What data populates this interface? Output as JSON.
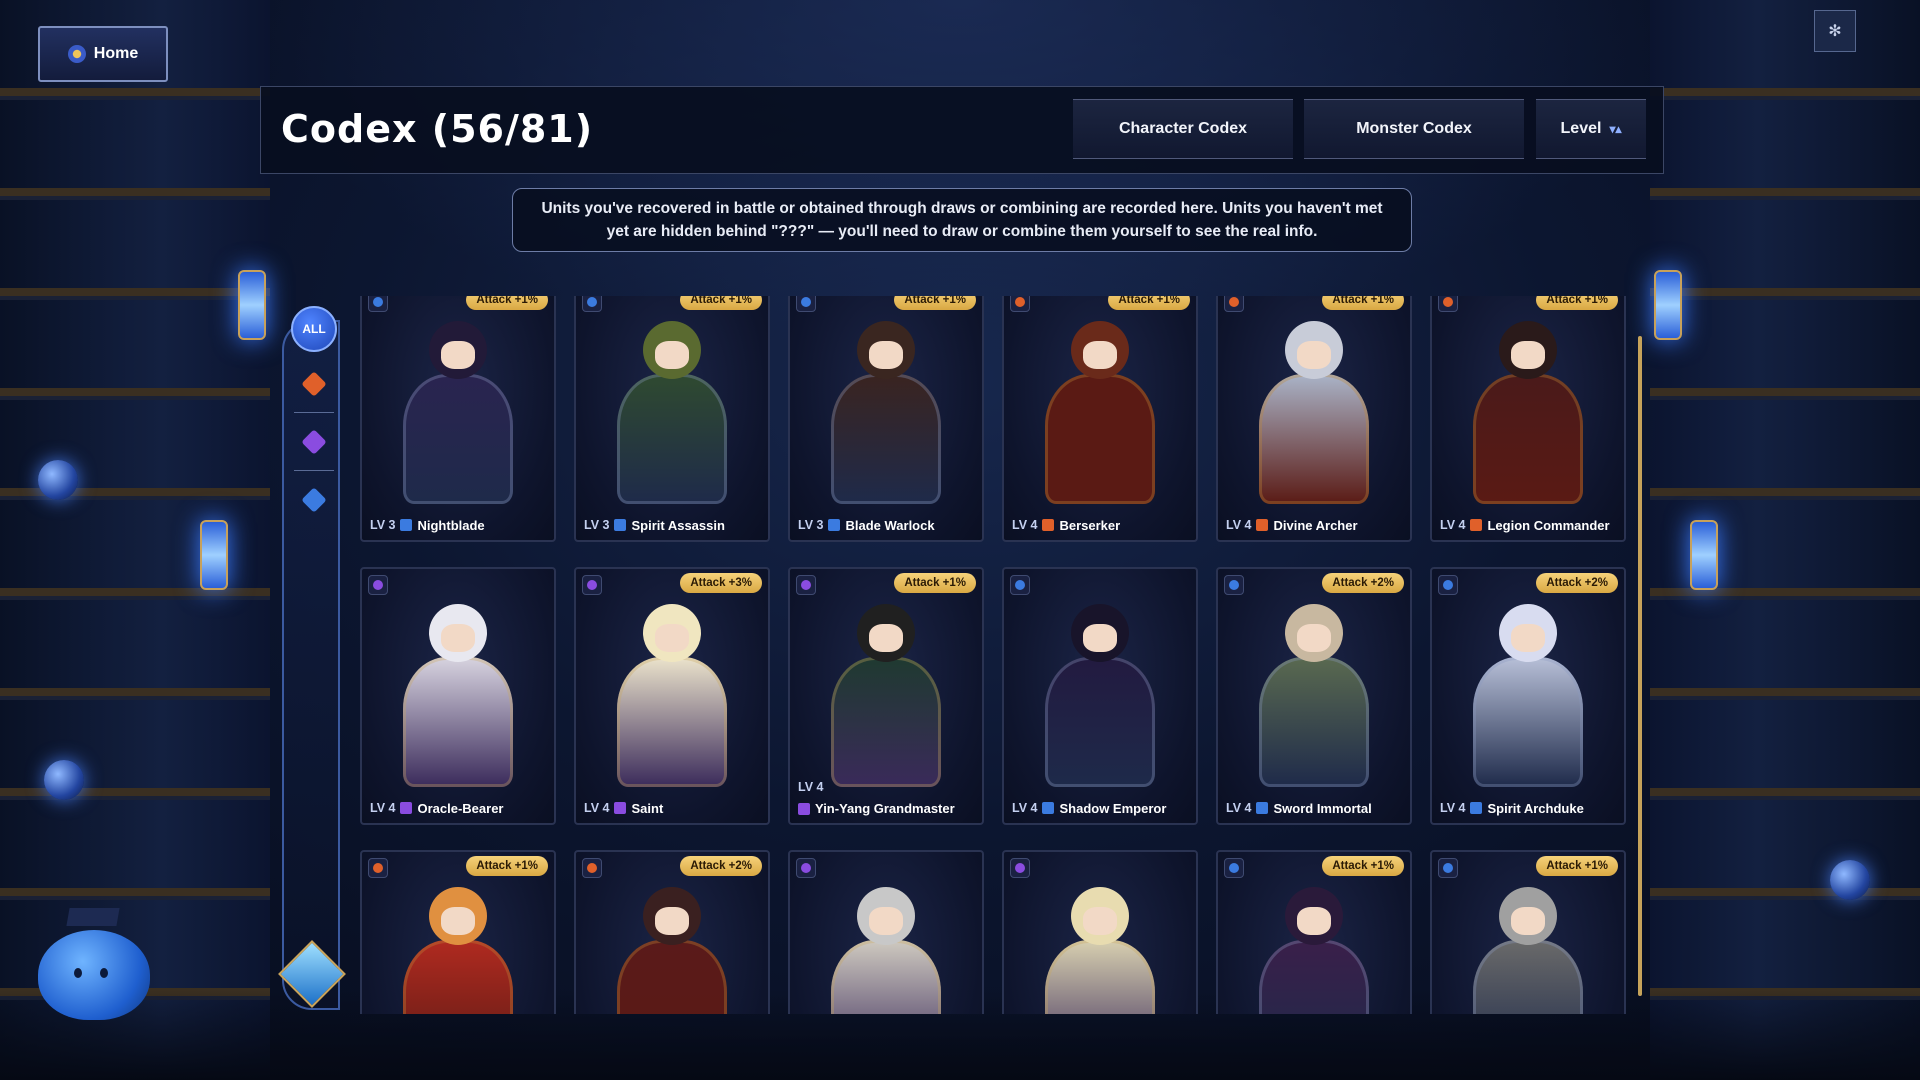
{
  "nav": {
    "home_label": "Home"
  },
  "header": {
    "title": "Codex (56/81)",
    "tabs": [
      "Character Codex",
      "Monster Codex"
    ],
    "sort_label": "Level"
  },
  "info_text": "Units you've recovered in battle or obtained through draws or combining are recorded here. Units you haven't met yet are hidden behind \"???\" — you'll need to draw or combine them yourself to see the real info.",
  "filters": {
    "all_label": "ALL",
    "items": [
      "fire-element",
      "arcane-element",
      "blue-element"
    ]
  },
  "colors": {
    "fire": "#e0602a",
    "arcane": "#8a4ce0",
    "water": "#3b7be0",
    "badge": "#f0c45a"
  },
  "cards": [
    {
      "level": "LV 3",
      "name": "Nightblade",
      "badge": "Attack +1%",
      "element": "water"
    },
    {
      "level": "LV 3",
      "name": "Spirit Assassin",
      "badge": "Attack +1%",
      "element": "water"
    },
    {
      "level": "LV 3",
      "name": "Blade Warlock",
      "badge": "Attack +1%",
      "element": "water"
    },
    {
      "level": "LV 4",
      "name": "Berserker",
      "badge": "Attack +1%",
      "element": "fire"
    },
    {
      "level": "LV 4",
      "name": "Divine Archer",
      "badge": "Attack +1%",
      "element": "fire"
    },
    {
      "level": "LV 4",
      "name": "Legion Commander",
      "badge": "Attack +1%",
      "element": "fire"
    },
    {
      "level": "LV 4",
      "name": "Oracle-Bearer",
      "badge": "",
      "element": "arcane"
    },
    {
      "level": "LV 4",
      "name": "Saint",
      "badge": "Attack +3%",
      "element": "arcane"
    },
    {
      "level": "LV 4",
      "name": "Yin-Yang Grandmaster",
      "badge": "Attack +1%",
      "element": "arcane"
    },
    {
      "level": "LV 4",
      "name": "Shadow Emperor",
      "badge": "",
      "element": "water"
    },
    {
      "level": "LV 4",
      "name": "Sword Immortal",
      "badge": "Attack +2%",
      "element": "water"
    },
    {
      "level": "LV 4",
      "name": "Spirit Archduke",
      "badge": "Attack +2%",
      "element": "water"
    },
    {
      "level": "",
      "name": "",
      "badge": "Attack +1%",
      "element": "fire"
    },
    {
      "level": "",
      "name": "",
      "badge": "Attack +2%",
      "element": "fire"
    },
    {
      "level": "",
      "name": "",
      "badge": "",
      "element": "arcane"
    },
    {
      "level": "",
      "name": "",
      "badge": "",
      "element": "arcane"
    },
    {
      "level": "",
      "name": "",
      "badge": "Attack +1%",
      "element": "water"
    },
    {
      "level": "",
      "name": "",
      "badge": "Attack +1%",
      "element": "water"
    }
  ]
}
